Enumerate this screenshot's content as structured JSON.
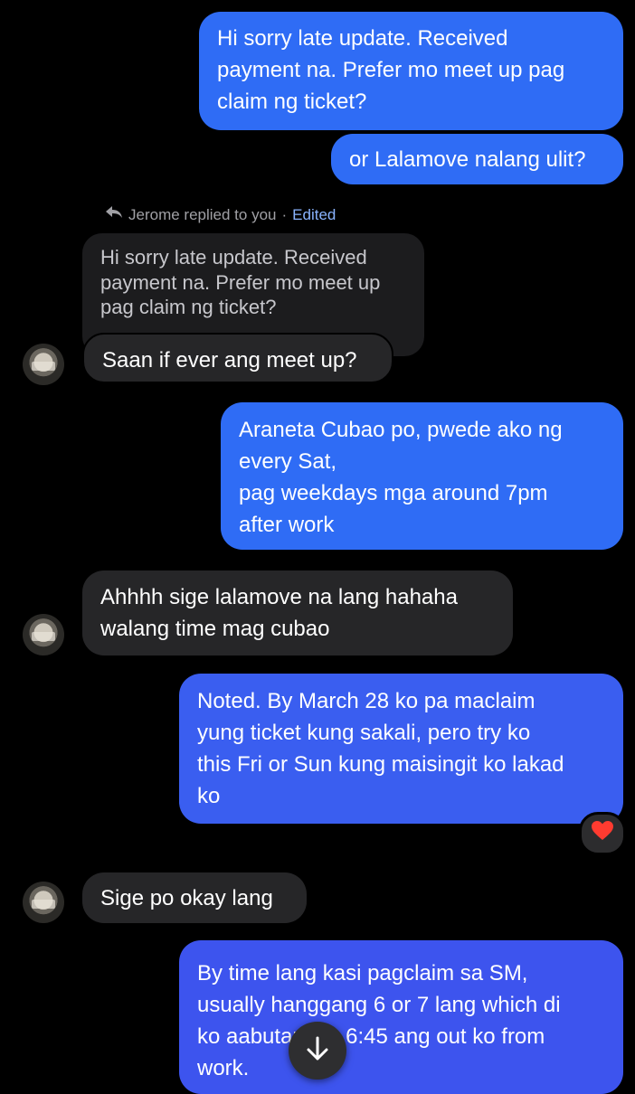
{
  "messages": [
    {
      "text": "Hi sorry late update. Received\npayment na. Prefer mo meet up pag\nclaim ng ticket?"
    },
    {
      "text": "or Lalamove nalang ulit?"
    },
    {
      "reply_to": "Jerome replied to you",
      "separator": "·",
      "edited": "Edited",
      "quoted": "Hi sorry late update. Received\npayment na. Prefer mo meet up\npag claim ng ticket?",
      "text": "Saan if ever ang meet up?"
    },
    {
      "text": "Araneta Cubao po, pwede ako  ng\nevery Sat,\npag weekdays mga around 7pm\nafter work"
    },
    {
      "text": "Ahhhh sige lalamove na lang hahaha\nwalang time mag cubao"
    },
    {
      "text": "Noted. By March 28 ko pa maclaim\nyung ticket kung sakali, pero try ko\nthis Fri or Sun kung maisingit ko lakad\nko",
      "reaction": "❤"
    },
    {
      "text": "Sige po okay lang"
    },
    {
      "text": "By time lang kasi pagclaim sa SM,\nusually hanggang 6 or 7 lang which di\nko aabutan din 6:45 ang out ko from\nwork."
    }
  ],
  "colors": {
    "outgoing": "#3567f0",
    "incoming": "#262628",
    "background": "#000000"
  },
  "icons": {
    "reply": "reply-arrow-icon",
    "scroll": "arrow-down-icon"
  }
}
